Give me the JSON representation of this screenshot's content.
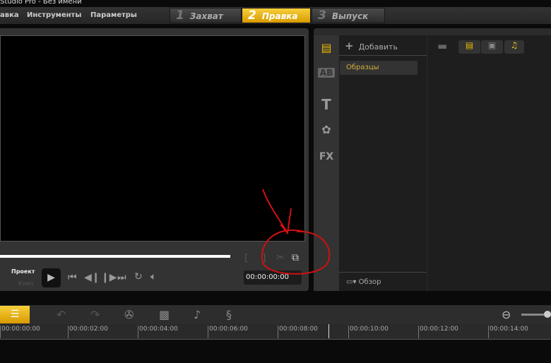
{
  "window": {
    "title": "Studio Pro - Без имени"
  },
  "menu": [
    "авка",
    "Инструменты",
    "Параметры"
  ],
  "steps": [
    {
      "num": "1",
      "label": "Захват"
    },
    {
      "num": "2",
      "label": "Правка"
    },
    {
      "num": "3",
      "label": "Выпуск"
    }
  ],
  "preview": {
    "project_label": "Проект",
    "clip_label": "Клип",
    "timecode": "00:00:00:00"
  },
  "library": {
    "add_label": "Добавить",
    "items": [
      "Образцы"
    ],
    "browse_label": "Обзор"
  },
  "timeline": {
    "ticks": [
      "00:00:00:00",
      "00:00:02:00",
      "00:00:04:00",
      "00:00:06:00",
      "00:00:08:00",
      "00:00:10:00",
      "00:00:12:00",
      "00:00:14:00"
    ]
  },
  "colors": {
    "accent": "#f0c020",
    "annotation": "#d01010"
  }
}
